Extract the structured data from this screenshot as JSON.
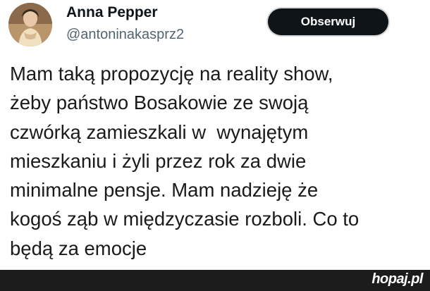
{
  "author": {
    "name": "Anna Pepper",
    "handle": "@antoninakasprz2"
  },
  "follow_button": {
    "label": "Obserwuj"
  },
  "post": {
    "lines": [
      "Mam taką propozycję na reality show,",
      "żeby państwo Bosakowie ze swoją",
      "czwórką zamieszkali w  wynajętym",
      "mieszkaniu i żyli przez rok za dwie",
      "minimalne pensje. Mam nadzieję że",
      "kogoś ząb w międzyczasie rozboli. Co to",
      "będą za emocje"
    ]
  },
  "footer": {
    "watermark": "hopaj.pl"
  }
}
